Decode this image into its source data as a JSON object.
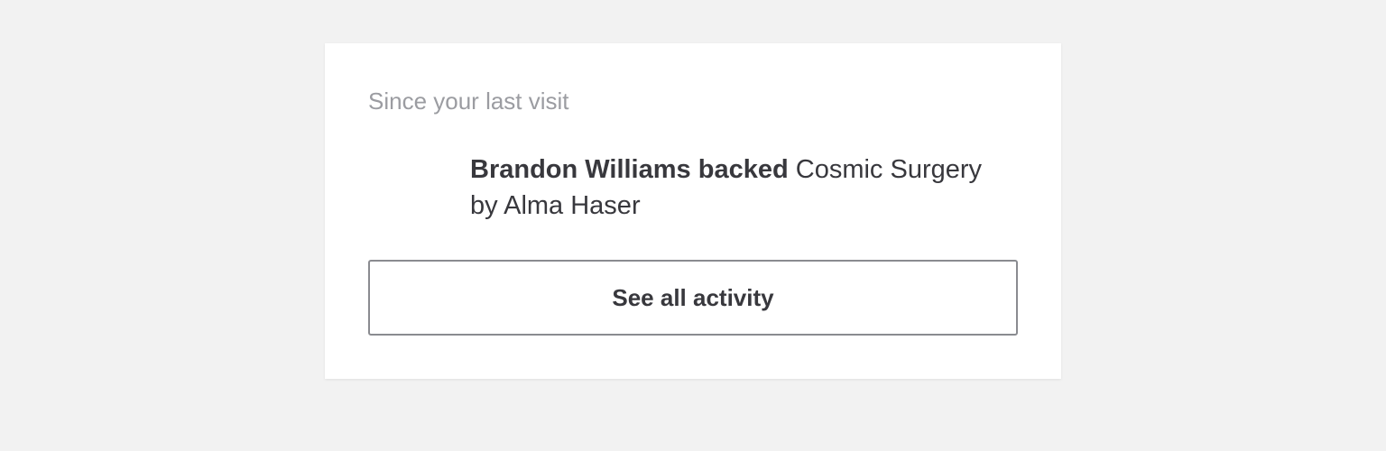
{
  "card": {
    "heading": "Since your last visit",
    "activity": {
      "actor": "Brandon Williams",
      "action": "backed",
      "project": "Cosmic Surgery",
      "by_prefix": "by",
      "creator": "Alma Haser"
    },
    "button_label": "See all activity"
  },
  "colors": {
    "page_background": "#f2f2f2",
    "card_background": "#ffffff",
    "heading_text": "#9b9ca1",
    "body_text": "#38383d",
    "button_border": "#8a8b90"
  }
}
